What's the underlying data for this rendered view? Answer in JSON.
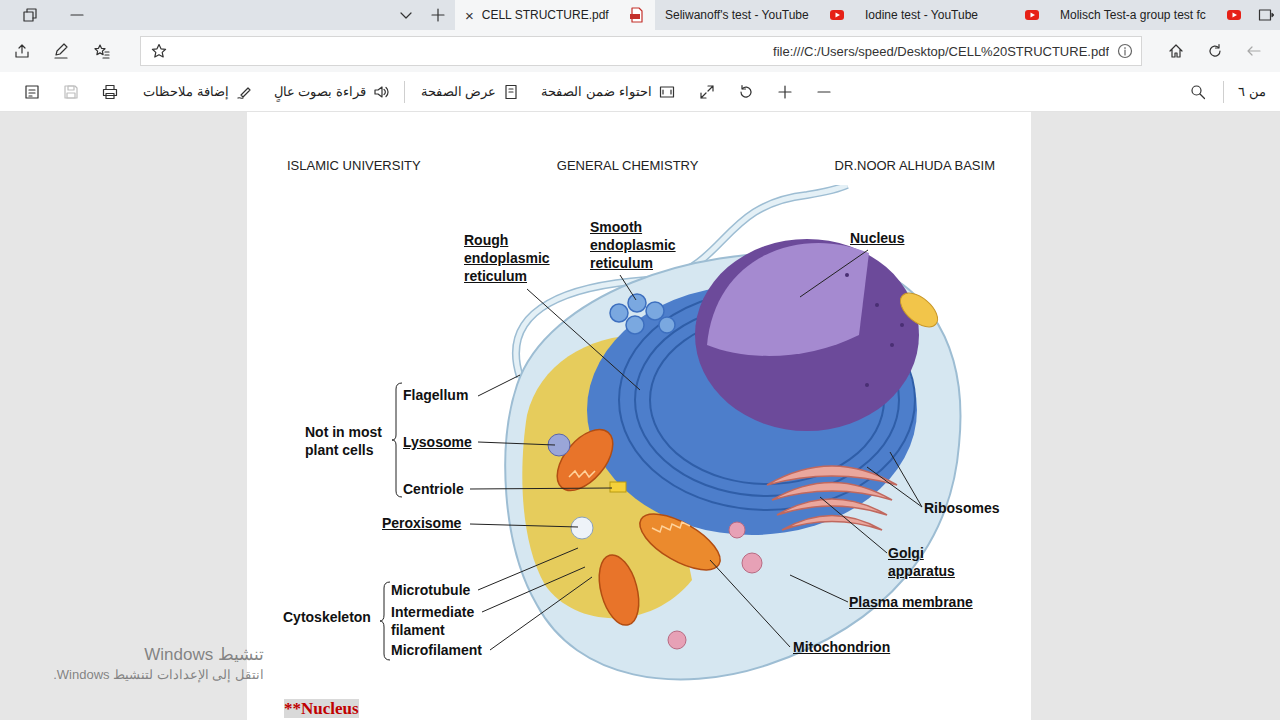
{
  "tabs": [
    {
      "label": "CELL STRUCTURE.pdf",
      "selected": true,
      "kind": "pdf",
      "close": "×"
    },
    {
      "label": "Seliwanoff's test - YouTube",
      "selected": false,
      "kind": "youtube"
    },
    {
      "label": "Iodine test - YouTube",
      "selected": false,
      "kind": "youtube"
    },
    {
      "label": "Molisch Test-a group test fc",
      "selected": false,
      "kind": "youtube"
    }
  ],
  "address_bar": {
    "url": "file:///C:/Users/speed/Desktop/CELL%20STRUCTURE.pdf"
  },
  "navigation": {
    "back_disabled": true
  },
  "pdf_toolbar": {
    "save_disabled": true,
    "buttons": [
      {
        "label": "إضافة ملاحظات"
      },
      {
        "label": "قراءة بصوت عالٍ"
      },
      {
        "label": "عرض الصفحة"
      },
      {
        "label": "احتواء ضمن الصفحة"
      }
    ],
    "page_count": "من ٦"
  },
  "document": {
    "header": [
      "ISLAMIC UNIVERSITY",
      "GENERAL CHEMISTRY",
      "DR.NOOR ALHUDA BASIM"
    ],
    "figure": {
      "labels": [
        {
          "text": "Rough\nendoplasmic\nreticulum",
          "underlined": true
        },
        {
          "text": "Smooth\nendoplasmic\nreticulum",
          "underlined": true
        },
        {
          "text": "Nucleus",
          "underlined": true
        },
        {
          "text": "Not in most\nplant cells",
          "underlined": false
        },
        {
          "text": "Flagellum",
          "underlined": false
        },
        {
          "text": "Lysosome",
          "underlined": true
        },
        {
          "text": "Centriole",
          "underlined": false
        },
        {
          "text": "Peroxisome",
          "underlined": true
        },
        {
          "text": "Ribosomes",
          "underlined": false
        },
        {
          "text": "Golgi\napparatus",
          "underlined": true
        },
        {
          "text": "Plasma membrane",
          "underlined": true
        },
        {
          "text": "Mitochondrion",
          "underlined": true
        },
        {
          "text": "Cytoskeleton",
          "underlined": false
        },
        {
          "text": "Microtubule",
          "underlined": false
        },
        {
          "text": "Intermediate\nfilament",
          "underlined": false
        },
        {
          "text": "Microfilament",
          "underlined": false
        }
      ]
    },
    "section_heading": "**Nucleus"
  },
  "watermark": {
    "title": "تنشيط Windows",
    "subtitle": "انتقل إلى الإعدادات لتنشيط Windows."
  }
}
